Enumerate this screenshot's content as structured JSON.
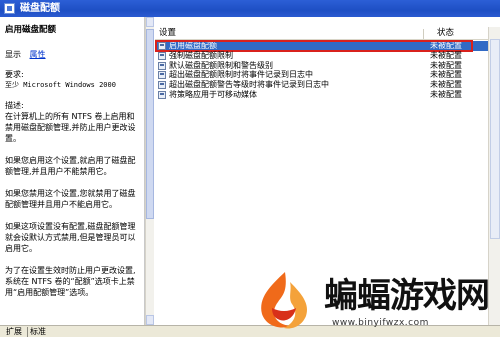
{
  "window": {
    "title": "磁盘配额"
  },
  "description": {
    "heading": "启用磁盘配额",
    "show_label": "显示",
    "properties_link": "属性",
    "requirements_label": "要求:",
    "requirements_value": "至少 Microsoft Windows 2000",
    "description_label": "描述:",
    "paragraphs": [
      "在计算机上的所有 NTFS 卷上启用和禁用磁盘配额管理,并防止用户更改设置。",
      "如果您启用这个设置,就启用了磁盘配额管理,并且用户不能禁用它。",
      "如果您禁用这个设置,您就禁用了磁盘配额管理并且用户不能启用它。",
      "如果这项设置没有配置,磁盘配额管理就会设默认方式禁用,但是管理员可以启用它。",
      "为了在设置生效时防止用户更改设置,系统在 NTFS 卷的“配额”选项卡上禁用“启用配额管理”选项。"
    ]
  },
  "list": {
    "columns": {
      "setting": "设置",
      "status": "状态"
    },
    "rows": [
      {
        "name": "启用磁盘配额",
        "status": "未被配置"
      },
      {
        "name": "强制磁盘配额限制",
        "status": "未被配置"
      },
      {
        "name": "默认磁盘配额限制和警告级别",
        "status": "未被配置"
      },
      {
        "name": "超出磁盘配额限制时将事件记录到日志中",
        "status": "未被配置"
      },
      {
        "name": "超出磁盘配额警告等级时将事件记录到日志中",
        "status": "未被配置"
      },
      {
        "name": "将策略应用于可移动媒体",
        "status": "未被配置"
      }
    ]
  },
  "tabs": {
    "extended": "扩展",
    "standard": "标准"
  },
  "watermark": {
    "brand": "蝙蝠游戏网",
    "url": "www.binyifwzx.com"
  },
  "colors": {
    "titlebar": "#1e4fc4",
    "selection": "#316ac5",
    "highlight": "#d9211c"
  }
}
